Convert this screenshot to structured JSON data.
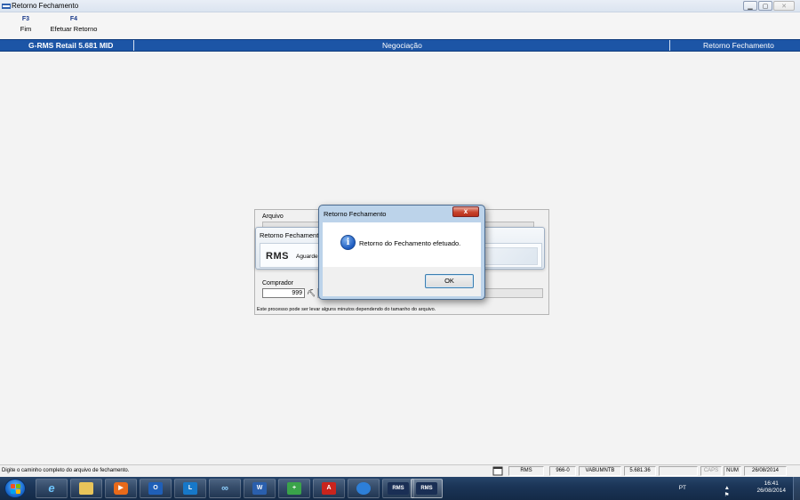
{
  "window": {
    "title": "Retorno Fechamento",
    "app_icon": "rms-app-icon",
    "controls": [
      "minimize",
      "maximize",
      "close"
    ]
  },
  "toolbar": {
    "items": [
      {
        "key": "F3",
        "label": "Fim"
      },
      {
        "key": "F4",
        "label": "Efetuar Retorno"
      }
    ]
  },
  "header": {
    "left": "G-RMS Retail 5.681 MID",
    "center": "Negociação",
    "right": "Retorno Fechamento",
    "color": "#1c55a6"
  },
  "form": {
    "arquivo_label": "Arquivo",
    "comprador_label": "Comprador",
    "comprador_value": "999",
    "note": "Este processo pode ser levar alguns minutos dependendo do tamanho do arquivo."
  },
  "progress_panel": {
    "title": "Retorno Fechamento",
    "logo_text": "RMS",
    "wait_text": "Aguarde"
  },
  "dialog": {
    "title": "Retorno Fechamento",
    "message": "Retorno do Fechamento efetuado.",
    "ok_label": "OK",
    "close_glyph": "x",
    "icon": "info-icon"
  },
  "statusbar": {
    "hint": "Digite o caminho completo do arquivo de fechamento.",
    "cells": [
      "RMS",
      "966-0",
      "VABUMNTB",
      "5.681.36",
      "",
      "CAPS",
      "NUM",
      "26/08/2014"
    ]
  },
  "taskbar": {
    "apps": [
      "internet-explorer",
      "file-explorer",
      "media-player",
      "outlook",
      "lync",
      "app-infinity",
      "word",
      "app-install",
      "acrobat",
      "app-globe",
      "rms-1",
      "rms-2"
    ],
    "app_label": "RMS",
    "tray": {
      "lang": "PT",
      "time": "16:41",
      "date": "26/08/2014"
    }
  }
}
